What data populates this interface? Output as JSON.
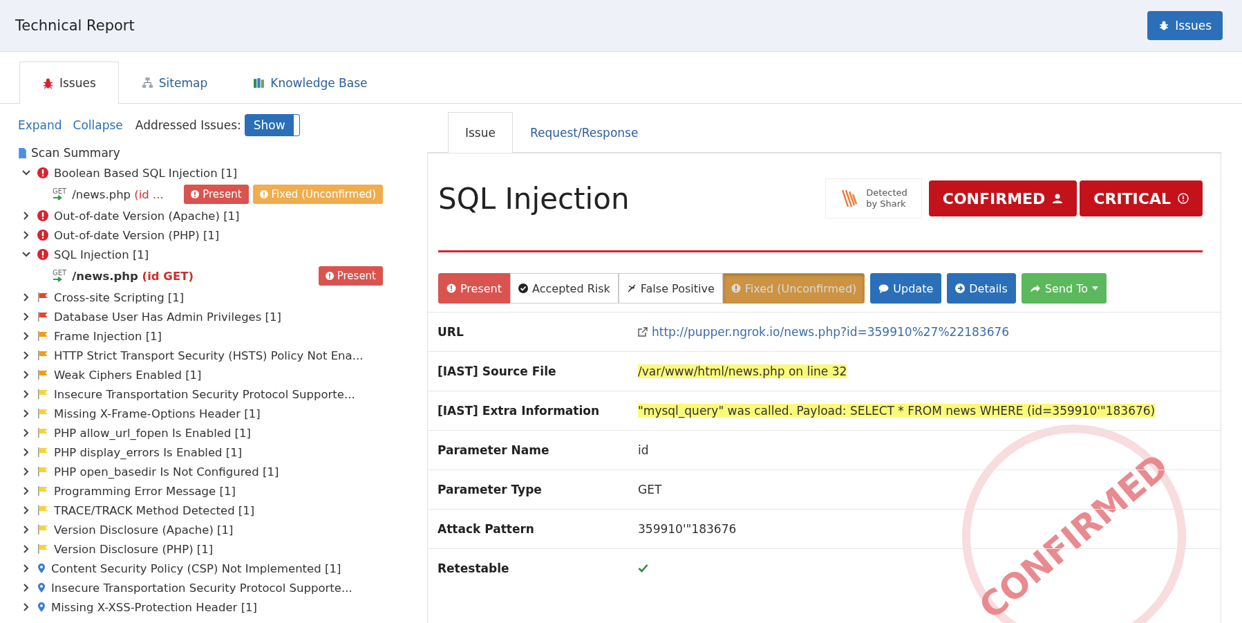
{
  "header": {
    "title": "Technical Report",
    "button": "Issues"
  },
  "tabs": [
    {
      "label": "Issues",
      "kind": "bug",
      "selected": true
    },
    {
      "label": "Sitemap",
      "kind": "sitemap",
      "selected": false
    },
    {
      "label": "Knowledge Base",
      "kind": "book",
      "selected": false
    }
  ],
  "toolbar": {
    "expand": "Expand",
    "collapse": "Collapse",
    "addressed_label": "Addressed Issues:",
    "toggle": {
      "label": "Show",
      "on": true
    }
  },
  "tree": {
    "summary": "Scan Summary",
    "items": [
      {
        "label": "Boolean Based SQL Injection [1]",
        "kind": "critical",
        "expanded": true,
        "children": [
          {
            "method": "GET",
            "path": "/news.php",
            "param": "(id ...",
            "selected": false,
            "badges": [
              {
                "label": "Present",
                "kind": "present"
              },
              {
                "label": "Fixed (Unconfirmed)",
                "kind": "fixed"
              }
            ]
          }
        ]
      },
      {
        "label": "Out-of-date Version (Apache) [1]",
        "kind": "critical",
        "expanded": false
      },
      {
        "label": "Out-of-date Version (PHP) [1]",
        "kind": "critical",
        "expanded": false
      },
      {
        "label": "SQL Injection [1]",
        "kind": "critical",
        "expanded": true,
        "children": [
          {
            "method": "GET",
            "path": "/news.php",
            "param": "(id GET)",
            "selected": true,
            "badges": [
              {
                "label": "Present",
                "kind": "present"
              }
            ]
          }
        ]
      },
      {
        "label": "Cross-site Scripting [1]",
        "kind": "high",
        "expanded": false
      },
      {
        "label": "Database User Has Admin Privileges [1]",
        "kind": "high",
        "expanded": false
      },
      {
        "label": "Frame Injection [1]",
        "kind": "medium",
        "expanded": false
      },
      {
        "label": "HTTP Strict Transport Security (HSTS) Policy Not Ena...",
        "kind": "medium",
        "expanded": false
      },
      {
        "label": "Weak Ciphers Enabled [1]",
        "kind": "medium",
        "expanded": false
      },
      {
        "label": "Insecure Transportation Security Protocol Supporte...",
        "kind": "low",
        "expanded": false
      },
      {
        "label": "Missing X-Frame-Options Header [1]",
        "kind": "low",
        "expanded": false
      },
      {
        "label": "PHP allow_url_fopen Is Enabled [1]",
        "kind": "low",
        "expanded": false
      },
      {
        "label": "PHP display_errors Is Enabled [1]",
        "kind": "low",
        "expanded": false
      },
      {
        "label": "PHP open_basedir Is Not Configured [1]",
        "kind": "low",
        "expanded": false
      },
      {
        "label": "Programming Error Message [1]",
        "kind": "low",
        "expanded": false
      },
      {
        "label": "TRACE/TRACK Method Detected [1]",
        "kind": "low",
        "expanded": false
      },
      {
        "label": "Version Disclosure (Apache) [1]",
        "kind": "low",
        "expanded": false
      },
      {
        "label": "Version Disclosure (PHP) [1]",
        "kind": "low",
        "expanded": false
      },
      {
        "label": "Content Security Policy (CSP) Not Implemented [1]",
        "kind": "info",
        "expanded": false
      },
      {
        "label": "Insecure Transportation Security Protocol Supporte...",
        "kind": "info",
        "expanded": false
      },
      {
        "label": "Missing X-XSS-Protection Header [1]",
        "kind": "info",
        "expanded": false
      }
    ]
  },
  "detail_tabs": [
    {
      "label": "Issue",
      "selected": true
    },
    {
      "label": "Request/Response",
      "selected": false
    }
  ],
  "issue": {
    "title": "SQL Injection",
    "detected": [
      "Detected",
      "by Shark"
    ],
    "confirmed": "CONFIRMED",
    "severity": "CRITICAL",
    "stamp": "CONFIRMED",
    "status_buttons": [
      {
        "label": "Present",
        "kind": "present",
        "selected": false
      },
      {
        "label": "Accepted Risk",
        "kind": "accepted",
        "selected": false
      },
      {
        "label": "False Positive",
        "kind": "false",
        "selected": false
      },
      {
        "label": "Fixed (Unconfirmed)",
        "kind": "fixed",
        "selected": true
      }
    ],
    "actions": [
      {
        "label": "Update",
        "kind": "update"
      },
      {
        "label": "Details",
        "kind": "details"
      },
      {
        "label": "Send To",
        "kind": "send"
      }
    ],
    "fields": [
      {
        "label": "URL",
        "kind": "link",
        "value": "http://pupper.ngrok.io/news.php?id=359910%27%22183676"
      },
      {
        "label": "[IAST] Source File",
        "kind": "highlight",
        "value": "/var/www/html/news.php on line 32"
      },
      {
        "label": "[IAST] Extra Information",
        "kind": "highlight",
        "value": "\"mysql_query\" was called. Payload: SELECT * FROM news WHERE (id=359910'\"183676)"
      },
      {
        "label": "Parameter Name",
        "kind": "text",
        "value": "id"
      },
      {
        "label": "Parameter Type",
        "kind": "text",
        "value": "GET"
      },
      {
        "label": "Attack Pattern",
        "kind": "text",
        "value": "359910'\"183676"
      },
      {
        "label": "Retestable",
        "kind": "check",
        "checked": true
      }
    ]
  }
}
